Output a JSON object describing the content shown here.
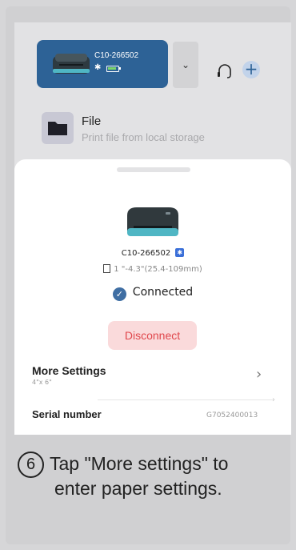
{
  "device_bar": {
    "device_name": "C10-266502",
    "bluetooth_glyph": "✱",
    "dropdown_glyph": "⌄",
    "plus_glyph": "+",
    "icons": [
      "printer-icon",
      "bluetooth-icon",
      "battery-icon",
      "chevron-down-icon",
      "headset-icon",
      "plus-icon"
    ],
    "accent_color": "#2d6296"
  },
  "file_row": {
    "title": "File",
    "subtitle": "Print file from local storage",
    "icon": "folder-icon"
  },
  "sheet": {
    "model": "C10-266502",
    "bluetooth_badge": "✱",
    "paper_range": "1 \"-4.3\"(25.4-109mm)",
    "status_check": "✓",
    "status": "Connected",
    "disconnect_label": "Disconnect",
    "more_settings_label": "More Settings",
    "more_settings_value": "4\"x 6\"",
    "chevron": "›",
    "serial_label": "Serial number",
    "serial_value": "G7052400013",
    "colors": {
      "disconnect_bg": "#fadadb",
      "disconnect_text": "#e0474c",
      "check": "#3f6ea3"
    }
  },
  "caption": {
    "step_number": "6",
    "line1": "Tap \"More settings\" to",
    "line2": "enter paper settings."
  }
}
